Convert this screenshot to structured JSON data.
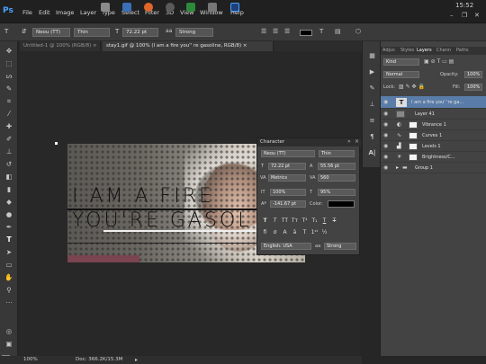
{
  "app": {
    "logo": "Ps",
    "clock": "15:52",
    "menu": [
      "File",
      "Edit",
      "Image",
      "Layer",
      "Type",
      "Select",
      "Filter",
      "3D",
      "View",
      "Window",
      "Help"
    ]
  },
  "options_bar": {
    "font_family": "Neou (TT)",
    "font_style": "Thin",
    "font_size": "72.22 pt",
    "anti_alias": "Strong"
  },
  "tabs": [
    {
      "label": "Untitled-1 @ 100% (RGB/8) ×"
    },
    {
      "label": "stay1.gif @ 100% (I am a fire  you'' re gasoline, RGB/8) ×"
    }
  ],
  "artwork": {
    "line1": "I AM A FIRE",
    "line2": "YOU'RE GASOL"
  },
  "character_panel": {
    "title": "Character",
    "font_family": "Neou (TT)",
    "font_style": "Thin",
    "size": "72.22 pt",
    "leading": "55.56 pt",
    "kerning": "Metrics",
    "tracking": "560",
    "vertical_scale": "100%",
    "horizontal_scale": "95%",
    "baseline_shift": "-141.67 pt",
    "color_label": "Color:",
    "language": "English: USA",
    "anti_alias": "Strong",
    "color": "#000000"
  },
  "layers_panel": {
    "tabs": [
      "Adjus",
      "Styles",
      "Layers",
      "Chann",
      "Paths"
    ],
    "kind_label": "Kind",
    "blend_mode": "Normal",
    "opacity_label": "Opacity:",
    "opacity": "100%",
    "lock_label": "Lock:",
    "fill_label": "Fill:",
    "fill": "100%",
    "layers": [
      {
        "name": "I am a fire  you' 're ga...",
        "type": "text",
        "selected": true
      },
      {
        "name": "Layer 41",
        "type": "pixel",
        "selected": false
      },
      {
        "name": "Vibrance 1",
        "type": "adjustment",
        "selected": false
      },
      {
        "name": "Curves 1",
        "type": "adjustment",
        "selected": false
      },
      {
        "name": "Levels 1",
        "type": "adjustment",
        "selected": false
      },
      {
        "name": "Brightness/C...",
        "type": "adjustment",
        "selected": false
      },
      {
        "name": "Group 1",
        "type": "group",
        "selected": false
      }
    ]
  },
  "status": {
    "zoom": "100%",
    "doc": "Doc: 366.2K/15.3M"
  }
}
